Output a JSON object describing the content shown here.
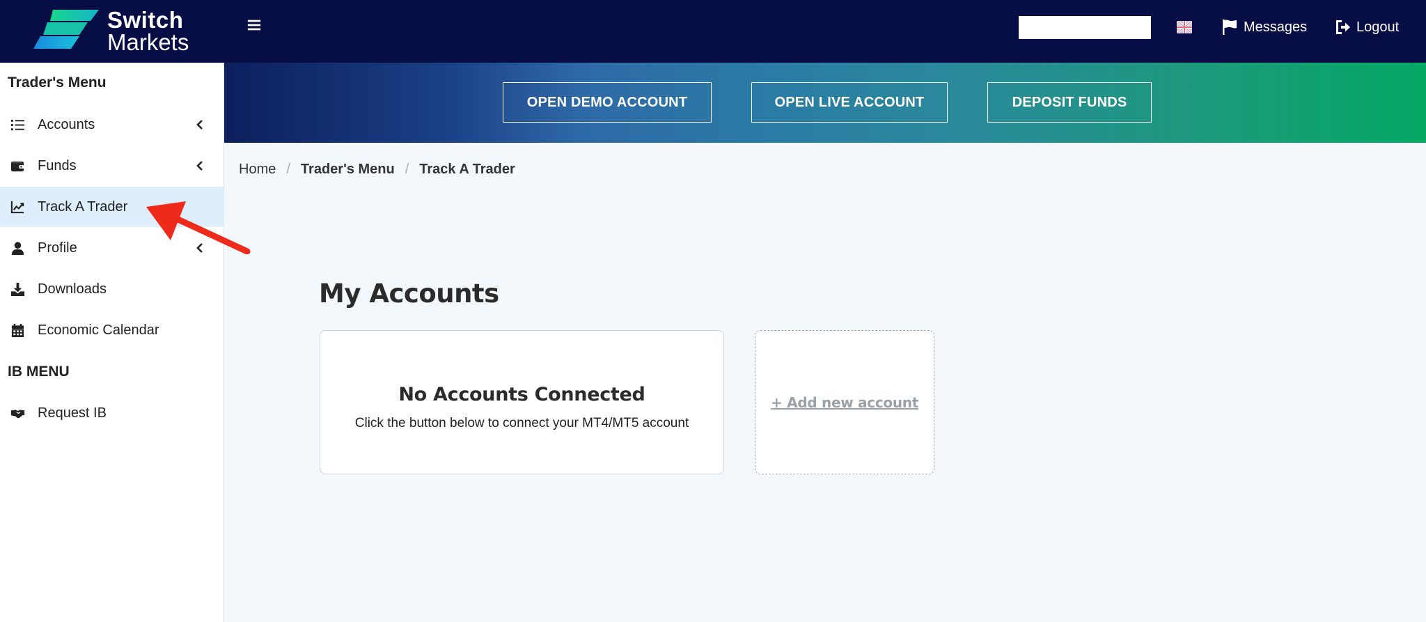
{
  "brand": {
    "line1": "Switch",
    "line2": "Markets"
  },
  "topbar": {
    "search_value": "",
    "messages_label": "Messages",
    "logout_label": "Logout"
  },
  "sidebar": {
    "traders_menu_heading": "Trader's Menu",
    "items": [
      {
        "label": "Accounts",
        "icon": "list-icon",
        "has_chevron": true
      },
      {
        "label": "Funds",
        "icon": "wallet-icon",
        "has_chevron": true
      },
      {
        "label": "Track A Trader",
        "icon": "chart-line-icon",
        "has_chevron": false,
        "active": true
      },
      {
        "label": "Profile",
        "icon": "user-icon",
        "has_chevron": true
      },
      {
        "label": "Downloads",
        "icon": "download-icon",
        "has_chevron": false
      },
      {
        "label": "Economic Calendar",
        "icon": "calendar-icon",
        "has_chevron": false
      }
    ],
    "ib_menu_heading": "IB MENU",
    "ib_items": [
      {
        "label": "Request IB",
        "icon": "handshake-icon"
      }
    ]
  },
  "banner": {
    "demo_label": "OPEN DEMO ACCOUNT",
    "live_label": "OPEN LIVE ACCOUNT",
    "deposit_label": "DEPOSIT FUNDS"
  },
  "breadcrumb": [
    "Home",
    "Trader's Menu",
    "Track A Trader"
  ],
  "main": {
    "title": "My Accounts",
    "empty_title": "No Accounts Connected",
    "empty_text": "Click the button below to connect your MT4/MT5 account",
    "add_label": "+ Add new account"
  },
  "colors": {
    "topbar": "#070d45",
    "active_item": "#dfeefc",
    "arrow": "#ee2a1b"
  }
}
